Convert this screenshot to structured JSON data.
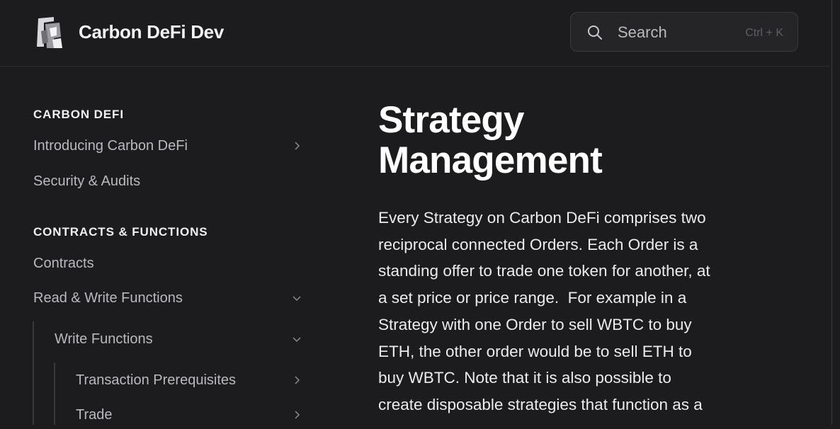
{
  "header": {
    "site_title": "Carbon DeFi Dev",
    "search": {
      "label": "Search",
      "shortcut": "Ctrl + K"
    }
  },
  "sidebar": {
    "sections": [
      {
        "heading": "CARBON DEFI",
        "items": [
          {
            "label": "Introducing Carbon DeFi",
            "chevron": "right"
          },
          {
            "label": "Security & Audits"
          }
        ]
      },
      {
        "heading": "CONTRACTS & FUNCTIONS",
        "items": [
          {
            "label": "Contracts"
          },
          {
            "label": "Read & Write Functions",
            "chevron": "down"
          },
          {
            "label": "Write Functions",
            "chevron": "down"
          },
          {
            "label": "Transaction Prerequisites",
            "chevron": "right"
          },
          {
            "label": "Trade",
            "chevron": "right"
          }
        ]
      }
    ]
  },
  "article": {
    "title_lines": [
      "Strategy",
      "Management"
    ],
    "paragraph_lines": [
      "Every Strategy on Carbon DeFi comprises two",
      "reciprocal connected Orders. Each Order is a",
      "standing offer to trade one token for another, at",
      "a set price or price range.  For example in a",
      "Strategy with one Order to sell WBTC to buy",
      "ETH, the other order would be to sell ETH to",
      "buy WBTC. Note that it is also possible to",
      "create disposable strategies that function as a"
    ]
  },
  "colors": {
    "background": "#1c1c1e",
    "text": "#e8e8ea",
    "muted": "#b9b9bf"
  }
}
